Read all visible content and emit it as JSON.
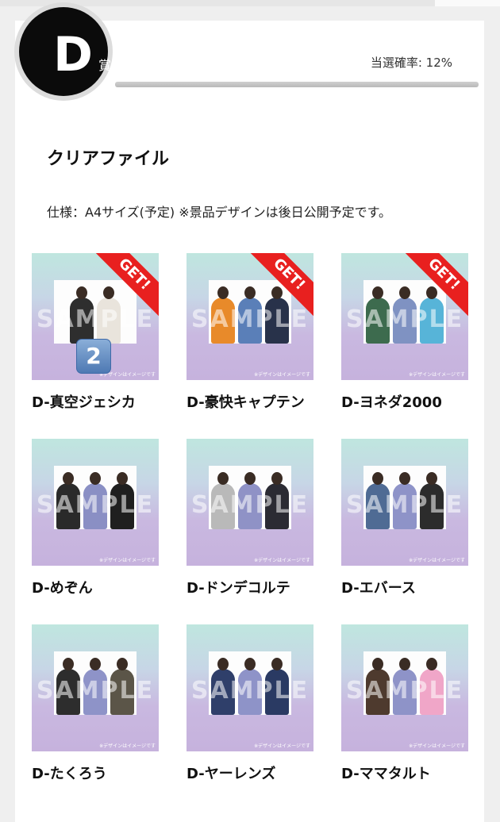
{
  "badge": {
    "letter": "D",
    "sub": "賞"
  },
  "rate": "当選確率: 12%",
  "title": "クリアファイル",
  "spec": "仕様：A4サイズ(予定) ※景品デザインは後日公開予定です。",
  "get_label": "GET!",
  "sample_text": "SAMPLE",
  "design_note": "※デザインはイメージです",
  "items": [
    {
      "label": "D-真空ジェシカ",
      "got": true,
      "count": "2"
    },
    {
      "label": "D-豪快キャプテン",
      "got": true,
      "count": ""
    },
    {
      "label": "D-ヨネダ2000",
      "got": true,
      "count": ""
    },
    {
      "label": "D-めぞん",
      "got": false,
      "count": ""
    },
    {
      "label": "D-ドンデコルテ",
      "got": false,
      "count": ""
    },
    {
      "label": "D-エバース",
      "got": false,
      "count": ""
    },
    {
      "label": "D-たくろう",
      "got": false,
      "count": ""
    },
    {
      "label": "D-ヤーレンズ",
      "got": false,
      "count": ""
    },
    {
      "label": "D-ママタルト",
      "got": false,
      "count": ""
    }
  ],
  "colors": {
    "get_ribbon": "#e8201f",
    "badge": "#0b0b0b",
    "count_badge": "#4e79b3"
  }
}
